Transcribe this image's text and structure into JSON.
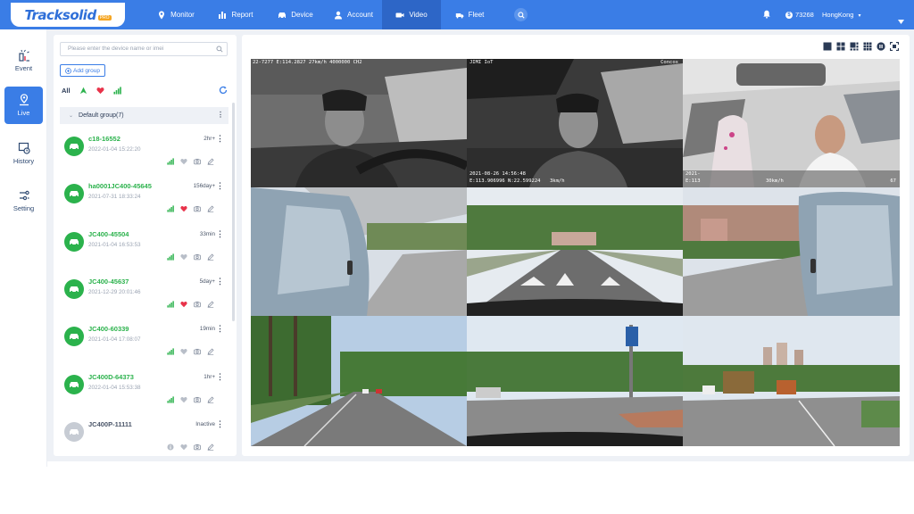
{
  "header": {
    "logo_text": "Tracksolid",
    "logo_badge": "PRO",
    "nav": [
      {
        "label": "Monitor",
        "icon": "location-pin-icon"
      },
      {
        "label": "Report",
        "icon": "bar-chart-icon"
      },
      {
        "label": "Device",
        "icon": "car-icon"
      },
      {
        "label": "Account",
        "icon": "person-icon"
      },
      {
        "label": "Video",
        "icon": "video-camera-icon",
        "active": true
      },
      {
        "label": "Fleet",
        "icon": "truck-icon"
      }
    ],
    "balance": "73268",
    "user": "HongKong"
  },
  "rail": [
    {
      "label": "Event",
      "icon": "event-icon"
    },
    {
      "label": "Live",
      "icon": "live-icon",
      "active": true
    },
    {
      "label": "History",
      "icon": "history-icon"
    },
    {
      "label": "Setting",
      "icon": "setting-icon"
    }
  ],
  "device_panel": {
    "search_placeholder": "Please enter the device name or imei",
    "add_group_label": "Add group",
    "filter_all": "All",
    "group_name": "Default group(7)",
    "devices": [
      {
        "name": "c18-16552",
        "time": "2022-01-04 15:22:20",
        "status": "2hr+",
        "online": true,
        "alarm": false
      },
      {
        "name": "ha0001JC400-45645",
        "time": "2021-07-31 18:33:24",
        "status": "156day+",
        "online": true,
        "alarm": true
      },
      {
        "name": "JC400-45504",
        "time": "2021-01-04 16:53:53",
        "status": "33min",
        "online": true,
        "alarm": false
      },
      {
        "name": "JC400-45637",
        "time": "2021-12-29 20:01:46",
        "status": "5day+",
        "online": true,
        "alarm": true
      },
      {
        "name": "JC400-60339",
        "time": "2021-01-04 17:08:07",
        "status": "19min",
        "online": true,
        "alarm": false
      },
      {
        "name": "JC400D-64373",
        "time": "2022-01-04 15:53:38",
        "status": "1hr+",
        "online": true,
        "alarm": false
      },
      {
        "name": "JC400P-11111",
        "time": "",
        "status": "Inactive",
        "online": false,
        "alarm": false
      }
    ]
  },
  "video_osd": {
    "cam1_top": "22-7277 E:114.2827 27km/h 4000000 CH2",
    "cam2_brand": "JIMI IoT",
    "cam2_brand_right": "Concox",
    "cam2_date": "2021-08-26 14:56:48",
    "cam2_coords": "E:113.906996 N:22.599224",
    "cam2_speed": "3km/h",
    "cam3_date": "2021-",
    "cam3_coords": "E:113",
    "cam3_speed": "30km/h",
    "cam3_ch": "67"
  },
  "colors": {
    "brand_blue": "#3a7de6",
    "online_green": "#2bb24c",
    "alarm_red": "#e8334a"
  }
}
